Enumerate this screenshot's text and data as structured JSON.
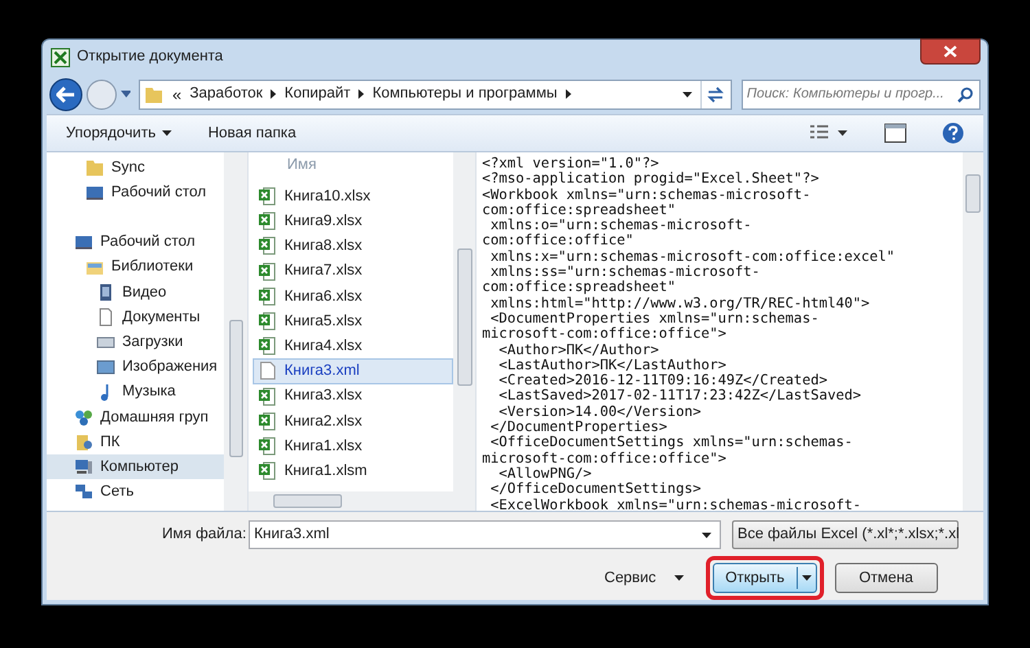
{
  "window": {
    "title": "Открытие документа"
  },
  "address": {
    "overflow": "«",
    "segments": [
      "Заработок",
      "Копирайт",
      "Компьютеры и программы"
    ],
    "search_placeholder": "Поиск: Компьютеры и прогр..."
  },
  "toolbar": {
    "organize": "Упорядочить",
    "new_folder": "Новая папка"
  },
  "nav": [
    {
      "label": "Sync",
      "selected": false
    },
    {
      "label": "Рабочий стол",
      "selected": false
    },
    {
      "label": "Рабочий стол",
      "selected": false
    },
    {
      "label": "Библиотеки",
      "selected": false
    },
    {
      "label": "Видео",
      "selected": false
    },
    {
      "label": "Документы",
      "selected": false
    },
    {
      "label": "Загрузки",
      "selected": false
    },
    {
      "label": "Изображения",
      "selected": false
    },
    {
      "label": "Музыка",
      "selected": false
    },
    {
      "label": "Домашняя груп",
      "selected": false
    },
    {
      "label": "ПК",
      "selected": false
    },
    {
      "label": "Компьютер",
      "selected": true
    },
    {
      "label": "Сеть",
      "selected": false
    }
  ],
  "files": {
    "column": "Имя",
    "items": [
      {
        "name": "Книга10.xlsx",
        "kind": "excel",
        "selected": false
      },
      {
        "name": "Книга9.xlsx",
        "kind": "excel",
        "selected": false
      },
      {
        "name": "Книга8.xlsx",
        "kind": "excel",
        "selected": false
      },
      {
        "name": "Книга7.xlsx",
        "kind": "excel",
        "selected": false
      },
      {
        "name": "Книга6.xlsx",
        "kind": "excel",
        "selected": false
      },
      {
        "name": "Книга5.xlsx",
        "kind": "excel",
        "selected": false
      },
      {
        "name": "Книга4.xlsx",
        "kind": "excel",
        "selected": false
      },
      {
        "name": "Книга3.xml",
        "kind": "xml",
        "selected": true
      },
      {
        "name": "Книга3.xlsx",
        "kind": "excel",
        "selected": false
      },
      {
        "name": "Книга2.xlsx",
        "kind": "excel",
        "selected": false
      },
      {
        "name": "Книга1.xlsx",
        "kind": "excel",
        "selected": false
      },
      {
        "name": "Книга1.xlsm",
        "kind": "excel",
        "selected": false
      }
    ]
  },
  "preview": [
    "<?xml version=\"1.0\"?>",
    "<?mso-application progid=\"Excel.Sheet\"?>",
    "<Workbook xmlns=\"urn:schemas-microsoft-",
    "com:office:spreadsheet\"",
    " xmlns:o=\"urn:schemas-microsoft-",
    "com:office:office\"",
    " xmlns:x=\"urn:schemas-microsoft-com:office:excel\"",
    " xmlns:ss=\"urn:schemas-microsoft-",
    "com:office:spreadsheet\"",
    " xmlns:html=\"http://www.w3.org/TR/REC-html40\">",
    " <DocumentProperties xmlns=\"urn:schemas-",
    "microsoft-com:office:office\">",
    "  <Author>ПК</Author>",
    "  <LastAuthor>ПК</LastAuthor>",
    "  <Created>2016-12-11T09:16:49Z</Created>",
    "  <LastSaved>2017-02-11T17:23:42Z</LastSaved>",
    "  <Version>14.00</Version>",
    " </DocumentProperties>",
    " <OfficeDocumentSettings xmlns=\"urn:schemas-",
    "microsoft-com:office:office\">",
    "  <AllowPNG/>",
    " </OfficeDocumentSettings>",
    " <ExcelWorkbook xmlns=\"urn:schemas-microsoft-"
  ],
  "bottom": {
    "filename_label": "Имя файла:",
    "filename": "Книга3.xml",
    "filter": "Все файлы Excel (*.xl*;*.xlsx;*.xl",
    "service": "Сервис",
    "open": "Открыть",
    "cancel": "Отмена",
    "open_highlighted": true
  }
}
